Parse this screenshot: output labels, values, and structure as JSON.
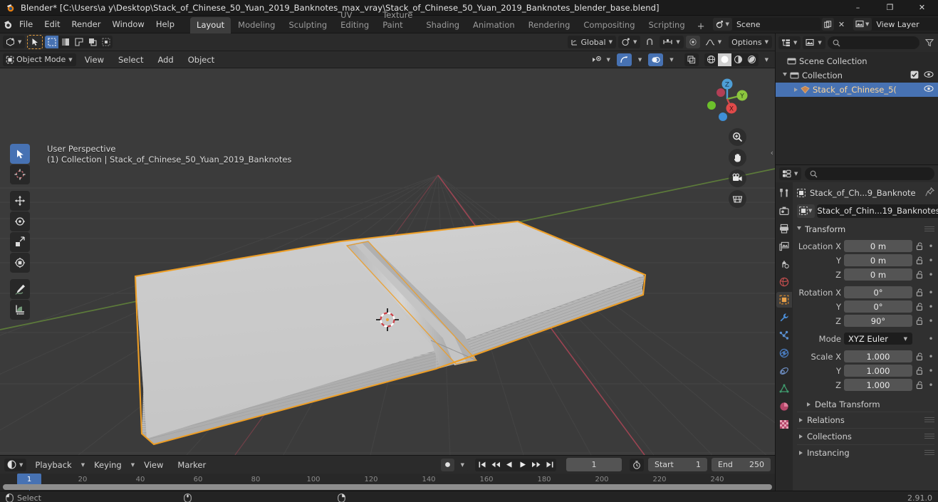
{
  "window": {
    "app_name": "Blender*",
    "title": "Blender* [C:\\Users\\a y\\Desktop\\Stack_of_Chinese_50_Yuan_2019_Banknotes_max_vray\\Stack_of_Chinese_50_Yuan_2019_Banknotes_blender_base.blend]",
    "minimize": "–",
    "maximize": "❐",
    "close": "✕"
  },
  "topbar": {
    "menus": [
      "File",
      "Edit",
      "Render",
      "Window",
      "Help"
    ],
    "workspaces": [
      {
        "label": "Layout",
        "active": true
      },
      {
        "label": "Modeling",
        "active": false
      },
      {
        "label": "Sculpting",
        "active": false
      },
      {
        "label": "UV Editing",
        "active": false
      },
      {
        "label": "Texture Paint",
        "active": false
      },
      {
        "label": "Shading",
        "active": false
      },
      {
        "label": "Animation",
        "active": false
      },
      {
        "label": "Rendering",
        "active": false
      },
      {
        "label": "Compositing",
        "active": false
      },
      {
        "label": "Scripting",
        "active": false
      }
    ],
    "add_workspace": "+",
    "scene_name": "Scene",
    "view_layer_name": "View Layer",
    "new_scene_icon": "copy-icon",
    "remove_scene_icon": "x-icon"
  },
  "viewport_header": {
    "editor_type": "editor-type-3d-viewport",
    "transform_orientation": "Global",
    "options_label": "Options",
    "mode": "Object Mode",
    "menus": [
      "View",
      "Select",
      "Add",
      "Object"
    ],
    "proportional_edit": "proportional-editing-icon",
    "snap": "magnet-icon",
    "shading_modes": [
      "wireframe",
      "solid",
      "material-preview",
      "rendered"
    ],
    "active_shading": "solid"
  },
  "viewport": {
    "perspective_label": "User Perspective",
    "scene_info": "(1) Collection | Stack_of_Chinese_50_Yuan_2019_Banknotes",
    "tools": [
      {
        "name": "tweak-select-box-tool",
        "selected": true
      },
      {
        "name": "cursor-tool",
        "selected": false
      },
      {
        "name": "move-tool",
        "selected": false
      },
      {
        "name": "rotate-tool",
        "selected": false
      },
      {
        "name": "scale-tool",
        "selected": false
      },
      {
        "name": "transform-tool",
        "selected": false
      },
      {
        "name": "annotate-tool",
        "selected": false
      },
      {
        "name": "measure-tool",
        "selected": false
      }
    ],
    "gizmo_axes": [
      "X",
      "Y",
      "Z"
    ],
    "nav_buttons": [
      "zoom-icon",
      "pan-hand-icon",
      "camera-view-icon",
      "toggle-orthographic-icon"
    ],
    "object_outline_color": "#ed9e26"
  },
  "timeline": {
    "editor_icon": "timeline-editor-icon",
    "menus": [
      "Playback",
      "Keying",
      "View",
      "Marker"
    ],
    "auto_keying": "record-icon",
    "transport": [
      "jump-to-start",
      "prev-keyframe",
      "play-reverse",
      "play",
      "next-keyframe",
      "jump-to-end"
    ],
    "current_frame": "1",
    "frame_range_icon": "stopwatch-icon",
    "start_label": "Start",
    "start_value": "1",
    "end_label": "End",
    "end_value": "250",
    "ticks": [
      "20",
      "40",
      "60",
      "80",
      "100",
      "120",
      "140",
      "160",
      "180",
      "200",
      "220",
      "240"
    ],
    "playhead_label": "1"
  },
  "outliner": {
    "display_mode_icon": "outliner-display-mode-icon",
    "filter_icon": "filter-icon",
    "search_placeholder": "",
    "search_value": "",
    "rows": [
      {
        "label": "Scene Collection",
        "icon": "collection-icon",
        "indent": 0,
        "selected": false,
        "expander": "",
        "checkbox": false,
        "eye": false
      },
      {
        "label": "Collection",
        "icon": "collection-icon",
        "indent": 1,
        "selected": false,
        "expander": "down",
        "checkbox": true,
        "eye": true
      },
      {
        "label": "Stack_of_Chinese_5(",
        "icon": "mesh-object-icon",
        "indent": 2,
        "selected": true,
        "expander": "right",
        "checkbox": false,
        "eye": true
      }
    ]
  },
  "properties": {
    "editor_icon": "properties-editor-icon",
    "search_placeholder": "",
    "tabs": [
      {
        "name": "tool-tab",
        "selected": false
      },
      {
        "name": "render-tab",
        "selected": false
      },
      {
        "name": "output-tab",
        "selected": false
      },
      {
        "name": "view-layer-tab",
        "selected": false
      },
      {
        "name": "scene-tab",
        "selected": false
      },
      {
        "name": "world-tab",
        "selected": false
      },
      {
        "name": "object-tab",
        "selected": true
      },
      {
        "name": "modifier-tab",
        "selected": false
      },
      {
        "name": "particles-tab",
        "selected": false
      },
      {
        "name": "physics-tab",
        "selected": false
      },
      {
        "name": "constraints-tab",
        "selected": false
      },
      {
        "name": "object-data-tab",
        "selected": false
      },
      {
        "name": "material-tab",
        "selected": false
      },
      {
        "name": "texture-tab",
        "selected": false
      }
    ],
    "breadcrumb": "Stack_of_Ch...9_Banknote",
    "pin_icon": "pin-icon",
    "object_name": "Stack_of_Chin...19_Banknotes",
    "transform_panel": {
      "title": "Transform",
      "rows": [
        {
          "label": "Location X",
          "value": "0 m"
        },
        {
          "label": "Y",
          "value": "0 m"
        },
        {
          "label": "Z",
          "value": "0 m"
        },
        {
          "label": "Rotation X",
          "value": "0°"
        },
        {
          "label": "Y",
          "value": "0°"
        },
        {
          "label": "Z",
          "value": "90°"
        }
      ],
      "mode_label": "Mode",
      "mode_value": "XYZ Euler",
      "scale_rows": [
        {
          "label": "Scale X",
          "value": "1.000"
        },
        {
          "label": "Y",
          "value": "1.000"
        },
        {
          "label": "Z",
          "value": "1.000"
        }
      ],
      "delta_transform": "Delta Transform"
    },
    "closed_panels": [
      "Relations",
      "Collections",
      "Instancing"
    ]
  },
  "statusbar": {
    "mouse_left_action": "Select",
    "mouse_middle_action": "",
    "mouse_right_action": "",
    "version": "2.91.0"
  }
}
